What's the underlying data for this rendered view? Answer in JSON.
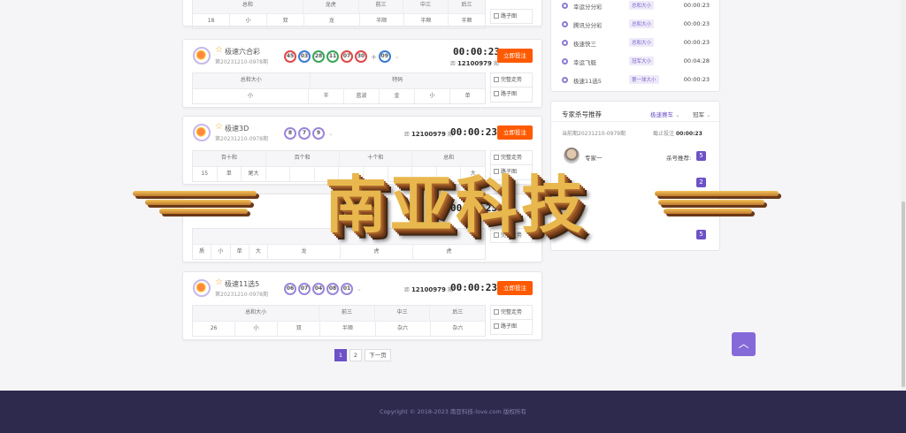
{
  "top_partial": {
    "headers": [
      "总和",
      "",
      "龙虎",
      "前三",
      "中三",
      "后三"
    ],
    "values": [
      "18",
      "小",
      "双",
      "龙",
      "半顺",
      "半顺",
      "半顺"
    ],
    "side": [
      "路子图"
    ]
  },
  "games": [
    {
      "name": "极速六合彩",
      "period": "第20231210-0978期",
      "balls": [
        "45",
        "03",
        "28",
        "11",
        "07",
        "30"
      ],
      "ball_colors": [
        "red",
        "blue",
        "green",
        "green",
        "red",
        "red"
      ],
      "special": "09",
      "special_color": "blue",
      "next_label": "距",
      "next_period": "12100979",
      "next_suffix": "期",
      "timer": "00:00:23",
      "bet": "立即投注",
      "headers": [
        "总和大小",
        "特码"
      ],
      "values": [
        "小",
        "半",
        "蓝波",
        "金",
        "小",
        "单"
      ],
      "side": [
        "完整走势",
        "路子图"
      ]
    },
    {
      "name": "极速3D",
      "period": "第20231210-0978期",
      "balls": [
        "8",
        "7",
        "9"
      ],
      "next_label": "距",
      "next_period": "12100979",
      "next_suffix": "期",
      "timer": "00:00:23",
      "bet": "立即投注",
      "headers": [
        "百十和",
        "百个和",
        "十个和",
        "总和"
      ],
      "values": [
        "15",
        "单",
        "尾大",
        "",
        "",
        "",
        "",
        "",
        "",
        "",
        "",
        "大",
        ""
      ],
      "side": [
        "完整走势",
        "路子图"
      ]
    },
    {
      "name": "",
      "period": "",
      "timer": "00:00:23",
      "next_period": "12100979",
      "values": [
        "质",
        "小",
        "单",
        "大",
        "龙",
        "虎",
        "虎"
      ],
      "side": [
        "完整走势"
      ]
    },
    {
      "name": "极速11选5",
      "period": "第20231210-0978期",
      "balls": [
        "06",
        "07",
        "04",
        "08",
        "01"
      ],
      "next_label": "距",
      "next_period": "12100979",
      "next_suffix": "期",
      "timer": "00:00:23",
      "bet": "立即投注",
      "headers": [
        "总和大小",
        "前三",
        "中三",
        "后三"
      ],
      "values": [
        "26",
        "小",
        "双",
        "半顺",
        "杂六",
        "杂六"
      ],
      "side": [
        "完整走势",
        "路子图"
      ]
    }
  ],
  "right_list": [
    {
      "name": "幸运分分彩",
      "tag": "总和大小",
      "time": "00:00:23"
    },
    {
      "name": "腾讯分分彩",
      "tag": "总和大小",
      "time": "00:00:23"
    },
    {
      "name": "极速快三",
      "tag": "总和大小",
      "time": "00:00:23"
    },
    {
      "name": "幸运飞艇",
      "tag": "冠军大小",
      "time": "00:04:28"
    },
    {
      "name": "极速11选5",
      "tag": "第一球大小",
      "time": "00:00:23"
    }
  ],
  "expert": {
    "title": "专家杀号推荐",
    "select1": "极速赛车",
    "select2": "冠军",
    "current": "当前期20231210-0979期",
    "deadline_label": "截止投注",
    "deadline": "00:00:23",
    "experts": [
      {
        "name": "专家一",
        "label": "杀号推荐:",
        "num": "5"
      }
    ],
    "nums2": [
      "2",
      "5"
    ]
  },
  "pager": {
    "pages": [
      "1",
      "2"
    ],
    "next": "下一页"
  },
  "footer": "Copyright © 2018-2023 南亚科技-love.com 版权所有",
  "watermark": "南亚科技",
  "colors": {
    "accent": "#6d52c7",
    "bet": "#ff5a00",
    "footer": "#2e2a4e"
  }
}
